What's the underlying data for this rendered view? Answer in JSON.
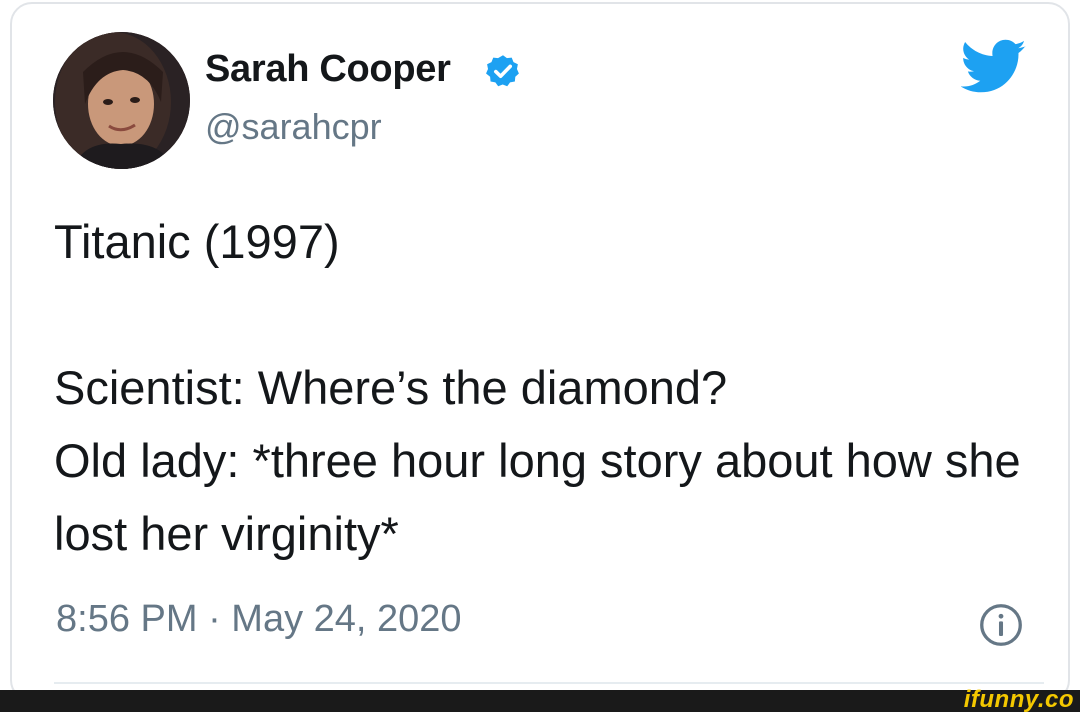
{
  "tweet": {
    "author": {
      "display_name": "Sarah Cooper",
      "handle": "@sarahcpr",
      "verified": true,
      "avatar_icon": "profile-photo"
    },
    "text": "Titanic (1997)\n\nScientist: Where’s the diamond?\nOld lady: *three hour long story about how she lost her virginity*",
    "timestamp": "8:56 PM · May 24, 2020",
    "platform_icon": "twitter-bird-icon",
    "info_icon": "info-icon"
  },
  "watermark": {
    "text": "ifunny.co"
  },
  "colors": {
    "twitter_blue": "#1da1f2",
    "text_primary": "#14171a",
    "text_secondary": "#657786",
    "watermark": "#f4c800"
  }
}
